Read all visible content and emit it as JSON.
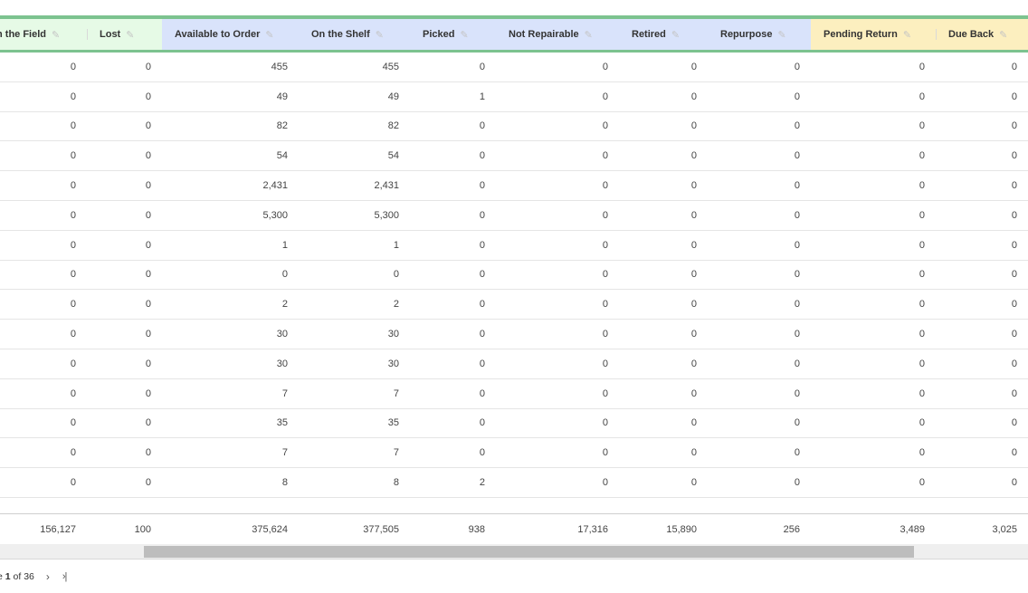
{
  "columns": [
    {
      "label": "n the Field",
      "group": "green"
    },
    {
      "label": "Lost",
      "group": "green"
    },
    {
      "label": "Available to Order",
      "group": "blue"
    },
    {
      "label": "On the Shelf",
      "group": "blue"
    },
    {
      "label": "Picked",
      "group": "blue"
    },
    {
      "label": "Not Repairable",
      "group": "blue"
    },
    {
      "label": "Retired",
      "group": "blue"
    },
    {
      "label": "Repurpose",
      "group": "blue"
    },
    {
      "label": "Pending Return",
      "group": "yellow"
    },
    {
      "label": "Due Back",
      "group": "yellow"
    }
  ],
  "rows": [
    [
      "0",
      "0",
      "455",
      "455",
      "0",
      "0",
      "0",
      "0",
      "0",
      "0"
    ],
    [
      "0",
      "0",
      "49",
      "49",
      "1",
      "0",
      "0",
      "0",
      "0",
      "0"
    ],
    [
      "0",
      "0",
      "82",
      "82",
      "0",
      "0",
      "0",
      "0",
      "0",
      "0"
    ],
    [
      "0",
      "0",
      "54",
      "54",
      "0",
      "0",
      "0",
      "0",
      "0",
      "0"
    ],
    [
      "0",
      "0",
      "2,431",
      "2,431",
      "0",
      "0",
      "0",
      "0",
      "0",
      "0"
    ],
    [
      "0",
      "0",
      "5,300",
      "5,300",
      "0",
      "0",
      "0",
      "0",
      "0",
      "0"
    ],
    [
      "0",
      "0",
      "1",
      "1",
      "0",
      "0",
      "0",
      "0",
      "0",
      "0"
    ],
    [
      "0",
      "0",
      "0",
      "0",
      "0",
      "0",
      "0",
      "0",
      "0",
      "0"
    ],
    [
      "0",
      "0",
      "2",
      "2",
      "0",
      "0",
      "0",
      "0",
      "0",
      "0"
    ],
    [
      "0",
      "0",
      "30",
      "30",
      "0",
      "0",
      "0",
      "0",
      "0",
      "0"
    ],
    [
      "0",
      "0",
      "30",
      "30",
      "0",
      "0",
      "0",
      "0",
      "0",
      "0"
    ],
    [
      "0",
      "0",
      "7",
      "7",
      "0",
      "0",
      "0",
      "0",
      "0",
      "0"
    ],
    [
      "0",
      "0",
      "35",
      "35",
      "0",
      "0",
      "0",
      "0",
      "0",
      "0"
    ],
    [
      "0",
      "0",
      "7",
      "7",
      "0",
      "0",
      "0",
      "0",
      "0",
      "0"
    ],
    [
      "0",
      "0",
      "8",
      "8",
      "2",
      "0",
      "0",
      "0",
      "0",
      "0"
    ]
  ],
  "totals": [
    "156,127",
    "100",
    "375,624",
    "377,505",
    "938",
    "17,316",
    "15,890",
    "256",
    "3,489",
    "3,025"
  ],
  "pager": {
    "prefix": "e ",
    "current": "1",
    "of_text": " of ",
    "total": "36",
    "next_icon": "›",
    "last_icon": "›|"
  },
  "colors": {
    "green_group": "#e6fae6",
    "blue_group": "#d9e3fb",
    "yellow_group": "#fcefbf",
    "header_stripe": "#7cc38f"
  }
}
